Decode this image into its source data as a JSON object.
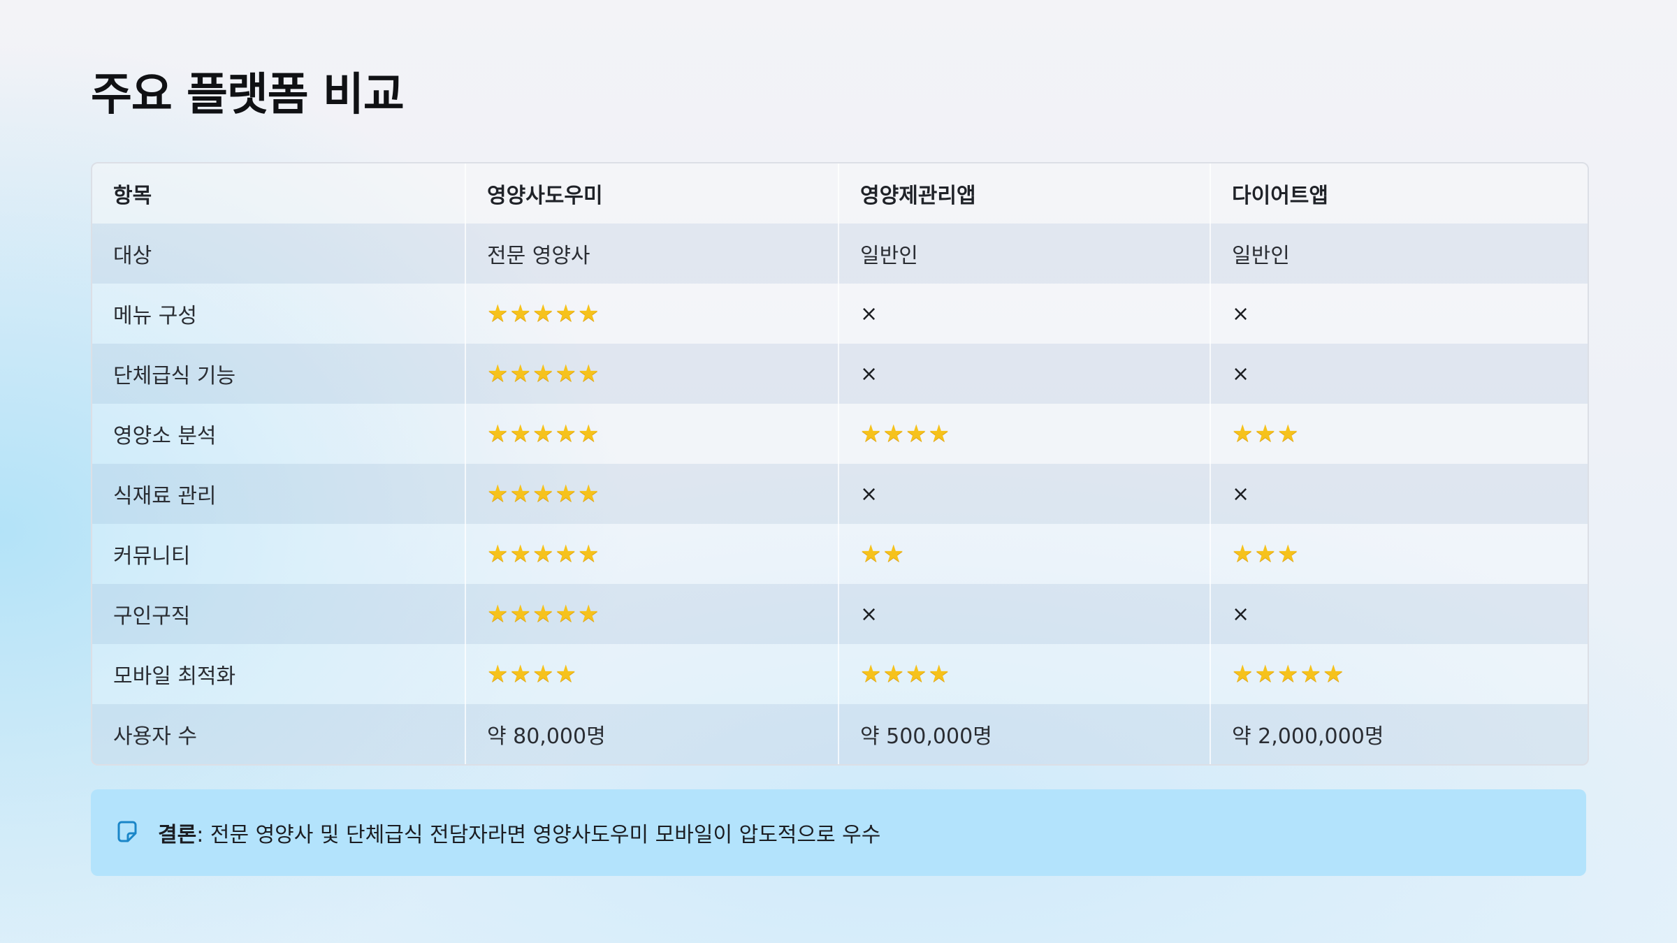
{
  "page": {
    "title": "주요 플랫폼 비교"
  },
  "table": {
    "headers": [
      "항목",
      "영양사도우미",
      "영양제관리앱",
      "다이어트앱"
    ],
    "rows": [
      {
        "item": "대상",
        "cells": [
          {
            "kind": "text",
            "value": "전문 영양사"
          },
          {
            "kind": "text",
            "value": "일반인"
          },
          {
            "kind": "text",
            "value": "일반인"
          }
        ]
      },
      {
        "item": "메뉴 구성",
        "cells": [
          {
            "kind": "stars",
            "value": 5
          },
          {
            "kind": "cross",
            "value": "×"
          },
          {
            "kind": "cross",
            "value": "×"
          }
        ]
      },
      {
        "item": "단체급식 기능",
        "cells": [
          {
            "kind": "stars",
            "value": 5
          },
          {
            "kind": "cross",
            "value": "×"
          },
          {
            "kind": "cross",
            "value": "×"
          }
        ]
      },
      {
        "item": "영양소 분석",
        "cells": [
          {
            "kind": "stars",
            "value": 5
          },
          {
            "kind": "stars",
            "value": 4
          },
          {
            "kind": "stars",
            "value": 3
          }
        ]
      },
      {
        "item": "식재료 관리",
        "cells": [
          {
            "kind": "stars",
            "value": 5
          },
          {
            "kind": "cross",
            "value": "×"
          },
          {
            "kind": "cross",
            "value": "×"
          }
        ]
      },
      {
        "item": "커뮤니티",
        "cells": [
          {
            "kind": "stars",
            "value": 5
          },
          {
            "kind": "stars",
            "value": 2
          },
          {
            "kind": "stars",
            "value": 3
          }
        ]
      },
      {
        "item": "구인구직",
        "cells": [
          {
            "kind": "stars",
            "value": 5
          },
          {
            "kind": "cross",
            "value": "×"
          },
          {
            "kind": "cross",
            "value": "×"
          }
        ]
      },
      {
        "item": "모바일 최적화",
        "cells": [
          {
            "kind": "stars",
            "value": 4
          },
          {
            "kind": "stars",
            "value": 4
          },
          {
            "kind": "stars",
            "value": 5
          }
        ]
      },
      {
        "item": "사용자 수",
        "cells": [
          {
            "kind": "text",
            "value": "약 80,000명"
          },
          {
            "kind": "text",
            "value": "약 500,000명"
          },
          {
            "kind": "text",
            "value": "약 2,000,000명"
          }
        ]
      }
    ]
  },
  "conclusion": {
    "icon": "memo-icon",
    "label": "결론",
    "text": ": 전문 영양사 및 단체급식 전담자라면 영양사도우미 모바일이 압도적으로 우수"
  },
  "colors": {
    "star": "#f6c21c",
    "note_background": "#b3e3fc",
    "note_icon": "#1a86c8"
  }
}
